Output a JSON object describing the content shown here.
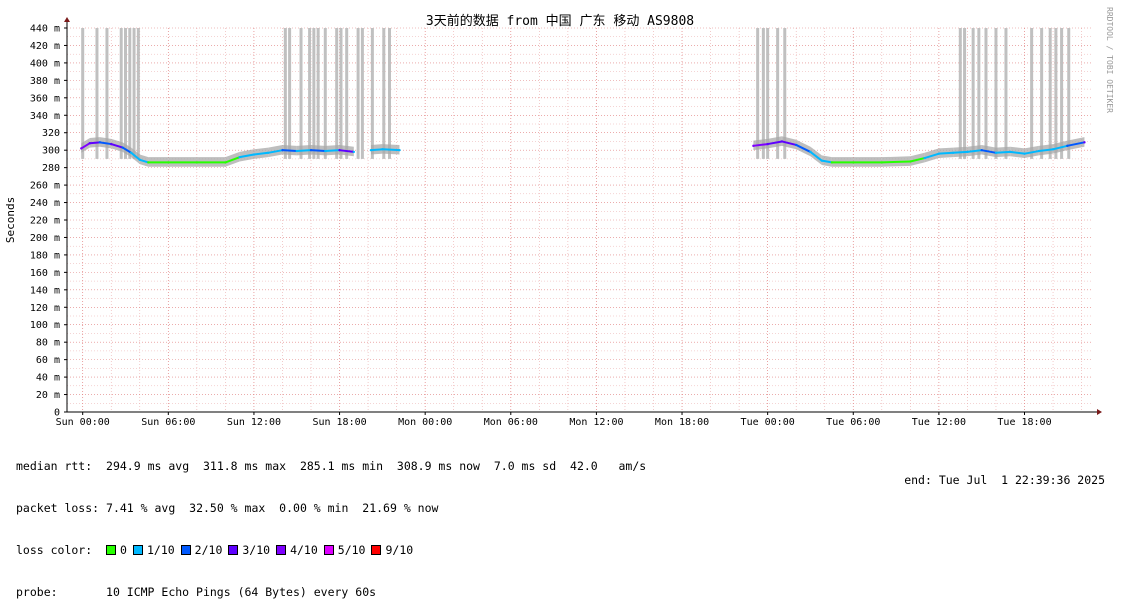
{
  "chart_data": {
    "type": "line",
    "title": "3天前的数据 from 中国 广东 移动 AS9808",
    "ylabel": "Seconds",
    "watermark": "RRDTOOL / TOBI OETIKER",
    "ylim": [
      0,
      440
    ],
    "y_ticks": [
      {
        "value": 0,
        "label": "0"
      },
      {
        "value": 20,
        "label": "20 m"
      },
      {
        "value": 40,
        "label": "40 m"
      },
      {
        "value": 60,
        "label": "60 m"
      },
      {
        "value": 80,
        "label": "80 m"
      },
      {
        "value": 100,
        "label": "100 m"
      },
      {
        "value": 120,
        "label": "120 m"
      },
      {
        "value": 140,
        "label": "140 m"
      },
      {
        "value": 160,
        "label": "160 m"
      },
      {
        "value": 180,
        "label": "180 m"
      },
      {
        "value": 200,
        "label": "200 m"
      },
      {
        "value": 220,
        "label": "220 m"
      },
      {
        "value": 240,
        "label": "240 m"
      },
      {
        "value": 260,
        "label": "260 m"
      },
      {
        "value": 280,
        "label": "280"
      },
      {
        "value": 300,
        "label": "300"
      },
      {
        "value": 320,
        "label": "320"
      },
      {
        "value": 340,
        "label": "340 m"
      },
      {
        "value": 360,
        "label": "360 m"
      },
      {
        "value": 380,
        "label": "380 m"
      },
      {
        "value": 400,
        "label": "400 m"
      },
      {
        "value": 420,
        "label": "420 m"
      },
      {
        "value": 440,
        "label": "440 m"
      }
    ],
    "x_unit": "hours since Sun 00:00",
    "xlim": [
      -1.1,
      70.8
    ],
    "x_ticks": [
      {
        "value": 0,
        "label": "Sun 00:00"
      },
      {
        "value": 6,
        "label": "Sun 06:00"
      },
      {
        "value": 12,
        "label": "Sun 12:00"
      },
      {
        "value": 18,
        "label": "Sun 18:00"
      },
      {
        "value": 24,
        "label": "Mon 00:00"
      },
      {
        "value": 30,
        "label": "Mon 06:00"
      },
      {
        "value": 36,
        "label": "Mon 12:00"
      },
      {
        "value": 42,
        "label": "Mon 18:00"
      },
      {
        "value": 48,
        "label": "Tue 00:00"
      },
      {
        "value": 54,
        "label": "Tue 06:00"
      },
      {
        "value": 60,
        "label": "Tue 12:00"
      },
      {
        "value": 66,
        "label": "Tue 18:00"
      }
    ],
    "median_rtt_series": [
      {
        "x": -0.1,
        "y": 302,
        "loss": 4
      },
      {
        "x": 0.5,
        "y": 308,
        "loss": 3
      },
      {
        "x": 1.2,
        "y": 309,
        "loss": 2
      },
      {
        "x": 2.0,
        "y": 307,
        "loss": 3
      },
      {
        "x": 2.8,
        "y": 303,
        "loss": 2
      },
      {
        "x": 3.4,
        "y": 297,
        "loss": 1
      },
      {
        "x": 4.0,
        "y": 289,
        "loss": 1
      },
      {
        "x": 4.6,
        "y": 286,
        "loss": 0
      },
      {
        "x": 6.0,
        "y": 286,
        "loss": 0
      },
      {
        "x": 8.0,
        "y": 286,
        "loss": 0
      },
      {
        "x": 10.0,
        "y": 286,
        "loss": 0
      },
      {
        "x": 11.0,
        "y": 292,
        "loss": 1
      },
      {
        "x": 12.0,
        "y": 295,
        "loss": 1
      },
      {
        "x": 13.0,
        "y": 297,
        "loss": 1
      },
      {
        "x": 14.0,
        "y": 300,
        "loss": 2
      },
      {
        "x": 15.0,
        "y": 299,
        "loss": 1
      },
      {
        "x": 16.0,
        "y": 300,
        "loss": 2
      },
      {
        "x": 17.0,
        "y": 299,
        "loss": 1
      },
      {
        "x": 18.0,
        "y": 300,
        "loss": 3
      },
      {
        "x": 19.0,
        "y": 298,
        "loss": 1
      },
      {
        "x": 19.6,
        "y": null,
        "loss": 0
      },
      {
        "x": 20.2,
        "y": 300,
        "loss": 1
      },
      {
        "x": 21.0,
        "y": 301,
        "loss": 1
      },
      {
        "x": 22.2,
        "y": 300,
        "loss": 1
      },
      {
        "x": 22.3,
        "y": null,
        "loss": 0
      },
      {
        "x": 47.0,
        "y": 305,
        "loss": 4
      },
      {
        "x": 48.0,
        "y": 307,
        "loss": 3
      },
      {
        "x": 49.0,
        "y": 310,
        "loss": 3
      },
      {
        "x": 50.0,
        "y": 306,
        "loss": 2
      },
      {
        "x": 51.0,
        "y": 298,
        "loss": 1
      },
      {
        "x": 51.8,
        "y": 288,
        "loss": 1
      },
      {
        "x": 52.5,
        "y": 286,
        "loss": 0
      },
      {
        "x": 54.0,
        "y": 286,
        "loss": 0
      },
      {
        "x": 56.0,
        "y": 286,
        "loss": 0
      },
      {
        "x": 58.0,
        "y": 287,
        "loss": 0
      },
      {
        "x": 59.0,
        "y": 291,
        "loss": 1
      },
      {
        "x": 60.0,
        "y": 296,
        "loss": 1
      },
      {
        "x": 61.0,
        "y": 297,
        "loss": 1
      },
      {
        "x": 62.0,
        "y": 298,
        "loss": 1
      },
      {
        "x": 63.0,
        "y": 300,
        "loss": 2
      },
      {
        "x": 64.0,
        "y": 297,
        "loss": 1
      },
      {
        "x": 65.0,
        "y": 298,
        "loss": 1
      },
      {
        "x": 66.0,
        "y": 296,
        "loss": 1
      },
      {
        "x": 67.0,
        "y": 299,
        "loss": 1
      },
      {
        "x": 68.0,
        "y": 301,
        "loss": 1
      },
      {
        "x": 69.0,
        "y": 305,
        "loss": 2
      },
      {
        "x": 70.2,
        "y": 309,
        "loss": 3
      }
    ],
    "loss_spikes": [
      {
        "x": 0.0,
        "y": 440
      },
      {
        "x": 1.0,
        "y": 440
      },
      {
        "x": 1.7,
        "y": 440
      },
      {
        "x": 2.7,
        "y": 440
      },
      {
        "x": 3.0,
        "y": 440
      },
      {
        "x": 3.3,
        "y": 440
      },
      {
        "x": 3.6,
        "y": 440
      },
      {
        "x": 3.9,
        "y": 440
      },
      {
        "x": 14.2,
        "y": 440
      },
      {
        "x": 14.5,
        "y": 440
      },
      {
        "x": 15.3,
        "y": 440
      },
      {
        "x": 15.9,
        "y": 440
      },
      {
        "x": 16.2,
        "y": 440
      },
      {
        "x": 16.5,
        "y": 440
      },
      {
        "x": 17.0,
        "y": 440
      },
      {
        "x": 17.8,
        "y": 440
      },
      {
        "x": 18.1,
        "y": 440
      },
      {
        "x": 18.5,
        "y": 440
      },
      {
        "x": 19.3,
        "y": 440
      },
      {
        "x": 19.6,
        "y": 440
      },
      {
        "x": 20.3,
        "y": 440
      },
      {
        "x": 21.1,
        "y": 440
      },
      {
        "x": 21.5,
        "y": 440
      },
      {
        "x": 47.3,
        "y": 440
      },
      {
        "x": 47.7,
        "y": 440
      },
      {
        "x": 48.0,
        "y": 440
      },
      {
        "x": 48.7,
        "y": 440
      },
      {
        "x": 49.2,
        "y": 440
      },
      {
        "x": 61.5,
        "y": 440
      },
      {
        "x": 61.8,
        "y": 440
      },
      {
        "x": 62.4,
        "y": 440
      },
      {
        "x": 62.8,
        "y": 440
      },
      {
        "x": 63.3,
        "y": 440
      },
      {
        "x": 64.0,
        "y": 440
      },
      {
        "x": 64.7,
        "y": 440
      },
      {
        "x": 66.5,
        "y": 440
      },
      {
        "x": 67.2,
        "y": 440
      },
      {
        "x": 67.8,
        "y": 440
      },
      {
        "x": 68.2,
        "y": 440
      },
      {
        "x": 68.6,
        "y": 440
      },
      {
        "x": 69.1,
        "y": 440
      }
    ],
    "grid": true
  },
  "legend": {
    "median_label": "median rtt:",
    "median_avg": "294.9 ms avg",
    "median_max": "311.8 ms max",
    "median_min": "285.1 ms min",
    "median_now": "308.9 ms now",
    "median_sd": "7.0 ms sd",
    "median_ams": "42.0   am/s",
    "loss_label": "packet loss:",
    "loss_avg": "7.41 % avg",
    "loss_max": "32.50 % max",
    "loss_min": "0.00 % min",
    "loss_now": "21.69 % now",
    "color_label": "loss color:",
    "colors": [
      {
        "label": "0",
        "color": "#26ff00"
      },
      {
        "label": "1/10",
        "color": "#00b8ff"
      },
      {
        "label": "2/10",
        "color": "#0059ff"
      },
      {
        "label": "3/10",
        "color": "#5e00ff"
      },
      {
        "label": "4/10",
        "color": "#7e00ff"
      },
      {
        "label": "5/10",
        "color": "#dd00ff"
      },
      {
        "label": "9/10",
        "color": "#ff0000"
      }
    ],
    "probe_label": "probe:",
    "probe_text": "10 ICMP Echo Pings (64 Bytes) every 60s",
    "end_text": "end: Tue Jul  1 22:39:36 2025"
  }
}
